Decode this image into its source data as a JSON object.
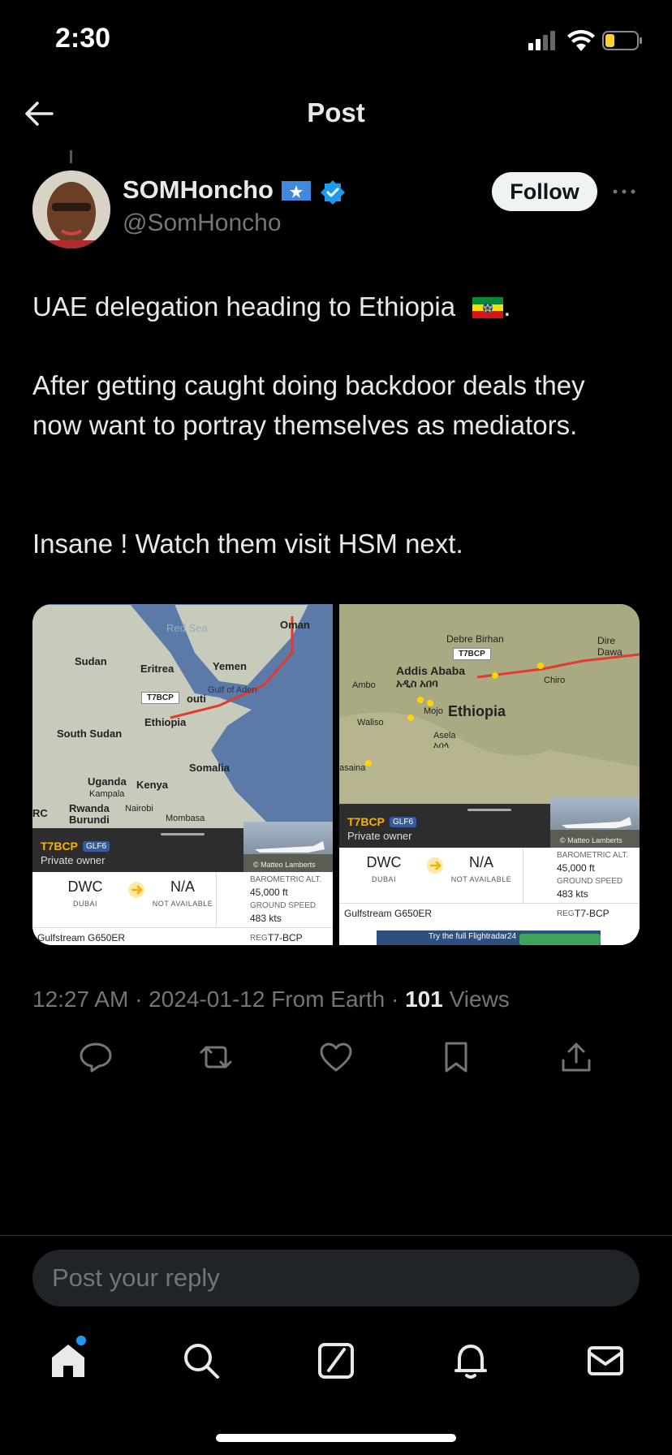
{
  "status_bar": {
    "time": "2:30"
  },
  "header": {
    "title": "Post"
  },
  "author": {
    "display_name": "SOMHoncho",
    "handle": "@SomHoncho",
    "follow_label": "Follow"
  },
  "post": {
    "line1": "UAE delegation heading to Ethiopia",
    "line1_end": ".",
    "line2": "After getting caught doing backdoor deals they now want to portray themselves as mediators.",
    "line3": "Insane ! Watch them visit HSM next."
  },
  "media": {
    "left": {
      "labels": {
        "red_sea": "Red Sea",
        "oman": "Oman",
        "sudan": "Sudan",
        "eritrea": "Eritrea",
        "yemen": "Yemen",
        "gulf_aden": "Gulf of Aden",
        "tag": "T7BCP",
        "ethiopia": "Ethiopia",
        "djibouti": "outi",
        "south_sudan": "South Sudan",
        "somalia": "Somalia",
        "uganda": "Uganda",
        "kenya": "Kenya",
        "kampala": "Kampala",
        "rwanda": "Rwanda",
        "nairobi": "Nairobi",
        "burundi": "Burundi",
        "mombasa": "Mombasa",
        "rc": "RC"
      },
      "card": {
        "callsign": "T7BCP",
        "type": "GLF6",
        "owner": "Private owner",
        "from_code": "DWC",
        "from_city": "DUBAI",
        "to_code": "N/A",
        "to_city": "NOT AVAILABLE",
        "credit": "© Matteo Lamberts",
        "alt_label": "BAROMETRIC ALT.",
        "alt_value": "45,000 ft",
        "speed_label": "GROUND SPEED",
        "speed_value": "483 kts",
        "model": "Gulfstream G650ER",
        "reg_label": "REG",
        "reg_value": "T7-BCP"
      }
    },
    "right": {
      "labels": {
        "debre_birhan": "Debre Birhan",
        "tag": "T7BCP",
        "dire_dawa": "Dire Dawa",
        "addis": "Addis Ababa",
        "addis_amharic": "አዲስ አበባ",
        "ambo": "Ambo",
        "chiro": "Chiro",
        "ethiopia": "Ethiopia",
        "mojo": "Mojo",
        "waliso": "Waliso",
        "asela": "Asela",
        "asela_amharic": "አሰላ",
        "asaina": "asaina"
      },
      "card": {
        "callsign": "T7BCP",
        "type": "GLF6",
        "owner": "Private owner",
        "from_code": "DWC",
        "from_city": "DUBAI",
        "to_code": "N/A",
        "to_city": "NOT AVAILABLE",
        "credit": "© Matteo Lamberts",
        "alt_label": "BAROMETRIC ALT.",
        "alt_value": "45,000 ft",
        "speed_label": "GROUND SPEED",
        "speed_value": "483 kts",
        "model": "Gulfstream G650ER",
        "reg_label": "REG",
        "reg_value": "T7-BCP",
        "promo": "Try the full Flightradar24"
      }
    }
  },
  "meta": {
    "time_date_source": "12:27 AM · 2024-01-12 From Earth · ",
    "views_count": "101",
    "views_label": " Views"
  },
  "actions": [
    "reply-icon",
    "repost-icon",
    "like-icon",
    "bookmark-icon",
    "share-icon"
  ],
  "reply": {
    "placeholder": "Post your reply"
  },
  "nav": [
    "home-icon",
    "search-icon",
    "grok-icon",
    "notifications-icon",
    "messages-icon"
  ],
  "colors": {
    "accent": "#1d9bf0",
    "background": "#000000",
    "muted": "#71767b",
    "text": "#e7e9ea"
  }
}
